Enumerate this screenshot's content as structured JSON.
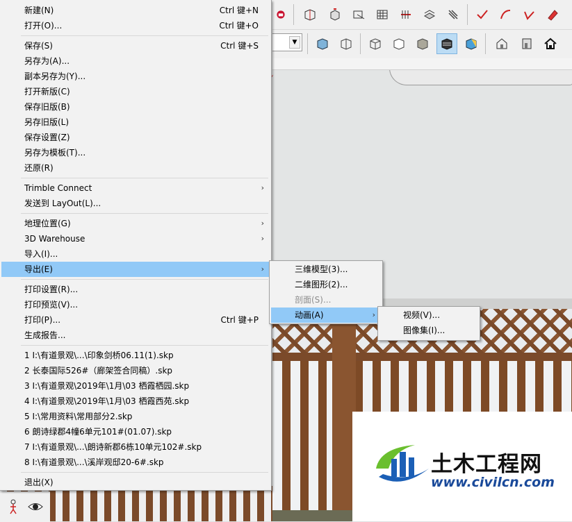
{
  "file_menu": {
    "items": [
      {
        "label": "新建(N)",
        "accel": "Ctrl 键+N"
      },
      {
        "label": "打开(O)...",
        "accel": "Ctrl 键+O"
      },
      {
        "label": "保存(S)",
        "accel": "Ctrl 键+S"
      },
      {
        "label": "另存为(A)..."
      },
      {
        "label": "副本另存为(Y)..."
      },
      {
        "label": "打开新版(C)"
      },
      {
        "label": "保存旧版(B)"
      },
      {
        "label": "另存旧版(L)"
      },
      {
        "label": "保存设置(Z)"
      },
      {
        "label": "另存为模板(T)..."
      },
      {
        "label": "还原(R)"
      },
      {
        "label": "Trimble Connect"
      },
      {
        "label": "发送到 LayOut(L)..."
      },
      {
        "label": "地理位置(G)"
      },
      {
        "label": "3D Warehouse"
      },
      {
        "label": "导入(I)..."
      },
      {
        "label": "导出(E)"
      },
      {
        "label": "打印设置(R)..."
      },
      {
        "label": "打印预览(V)..."
      },
      {
        "label": "打印(P)...",
        "accel": "Ctrl 键+P"
      },
      {
        "label": "生成报告..."
      },
      {
        "label": "1 I:\\有道景观\\...\\印象剑桥06.11(1).skp"
      },
      {
        "label": "2 长泰国际526#（廊架签合同稿）.skp"
      },
      {
        "label": "3 I:\\有道景观\\2019年\\1月\\03 栖霞栖园.skp"
      },
      {
        "label": "4 I:\\有道景观\\2019年\\1月\\03 栖霞西苑.skp"
      },
      {
        "label": "5 I:\\常用资料\\常用部分2.skp"
      },
      {
        "label": "6 朗诗绿郡4幢6单元101#(01.07).skp"
      },
      {
        "label": "7 I:\\有道景观\\...\\朗诗新郡6栋10单元102#.skp"
      },
      {
        "label": "8 I:\\有道景观\\...\\溪岸观邸20-6#.skp"
      },
      {
        "label": "退出(X)"
      }
    ]
  },
  "export_menu": {
    "items": [
      {
        "label": "三维模型(3)..."
      },
      {
        "label": "二维图形(2)..."
      },
      {
        "label": "剖面(S)...",
        "disabled": true
      },
      {
        "label": "动画(A)"
      }
    ]
  },
  "animation_menu": {
    "items": [
      {
        "label": "视频(V)..."
      },
      {
        "label": "图像集(I)..."
      }
    ]
  },
  "toolbar": {
    "row1_icons": [
      "box-wire-icon",
      "move-box-icon",
      "section-box-icon",
      "section-fill-icon",
      "section-arrow-icon",
      "stack-layers-icon",
      "stripes-icon",
      "check-pencil-icon",
      "arc-pencil-icon",
      "curve-pencil-icon",
      "red-pencil-icon"
    ],
    "row2_icons": [
      "iso-cube-icon",
      "wire-cube-icon",
      "hidden-line-cube-icon",
      "shaded-cube-icon",
      "textured-cube-icon",
      "monochrome-cube-icon",
      "xray-cube-icon",
      "house-iso-icon",
      "house-front-icon",
      "house-icon"
    ],
    "active_style_index": 5
  },
  "bottom_tools": [
    "walk-person-icon",
    "look-around-eye-icon"
  ],
  "watermark": {
    "name": "土木工程网",
    "url": "www.civilcn.com",
    "brand_colors": {
      "green": "#6abf2e",
      "blue": "#1b5fb6"
    }
  }
}
